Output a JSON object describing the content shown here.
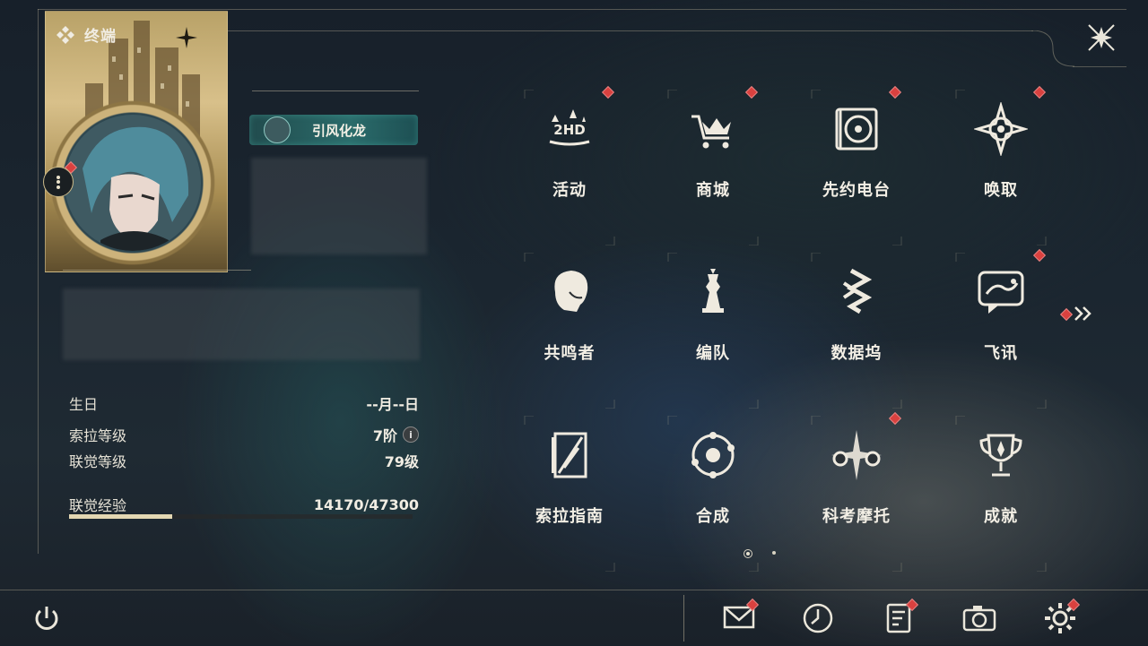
{
  "header": {
    "title": "终端"
  },
  "profile": {
    "title_badge": "引风化龙",
    "info": [
      {
        "label": "生日",
        "value": "--月--日"
      },
      {
        "label": "索拉等级",
        "value": "7阶",
        "has_info_icon": true
      },
      {
        "label": "联觉等级",
        "value": "79级"
      }
    ],
    "exp": {
      "label": "联觉经验",
      "value": "14170/47300",
      "current": 14170,
      "max": 47300
    }
  },
  "menu": [
    {
      "label": "活动",
      "icon": "event-2hd-icon",
      "badge": true
    },
    {
      "label": "商城",
      "icon": "shop-crown-cart-icon",
      "badge": true
    },
    {
      "label": "先约电台",
      "icon": "radio-record-icon",
      "badge": true
    },
    {
      "label": "唤取",
      "icon": "convene-star-icon",
      "badge": true
    },
    {
      "label": "共鸣者",
      "icon": "resonator-head-icon",
      "badge": false
    },
    {
      "label": "编队",
      "icon": "chess-team-icon",
      "badge": false
    },
    {
      "label": "数据坞",
      "icon": "data-bank-icon",
      "badge": false
    },
    {
      "label": "飞讯",
      "icon": "message-bubble-icon",
      "badge": true
    },
    {
      "label": "索拉指南",
      "icon": "guide-book-icon",
      "badge": false
    },
    {
      "label": "合成",
      "icon": "synthesis-circle-icon",
      "badge": false
    },
    {
      "label": "科考摩托",
      "icon": "motorcycle-icon",
      "badge": true
    },
    {
      "label": "成就",
      "icon": "trophy-icon",
      "badge": false
    }
  ],
  "pagination": {
    "current": 1,
    "total": 2
  },
  "bottom_bar": [
    {
      "name": "mail",
      "icon": "mail-icon",
      "badge": true
    },
    {
      "name": "time",
      "icon": "clock-icon",
      "badge": false
    },
    {
      "name": "notes",
      "icon": "notice-icon",
      "badge": true
    },
    {
      "name": "camera",
      "icon": "camera-icon",
      "badge": false
    },
    {
      "name": "settings",
      "icon": "gear-icon",
      "badge": true
    }
  ],
  "colors": {
    "badge_red": "#d9413f",
    "accent_gold": "#e3d7b2",
    "title_teal": "#2b6c6b"
  }
}
